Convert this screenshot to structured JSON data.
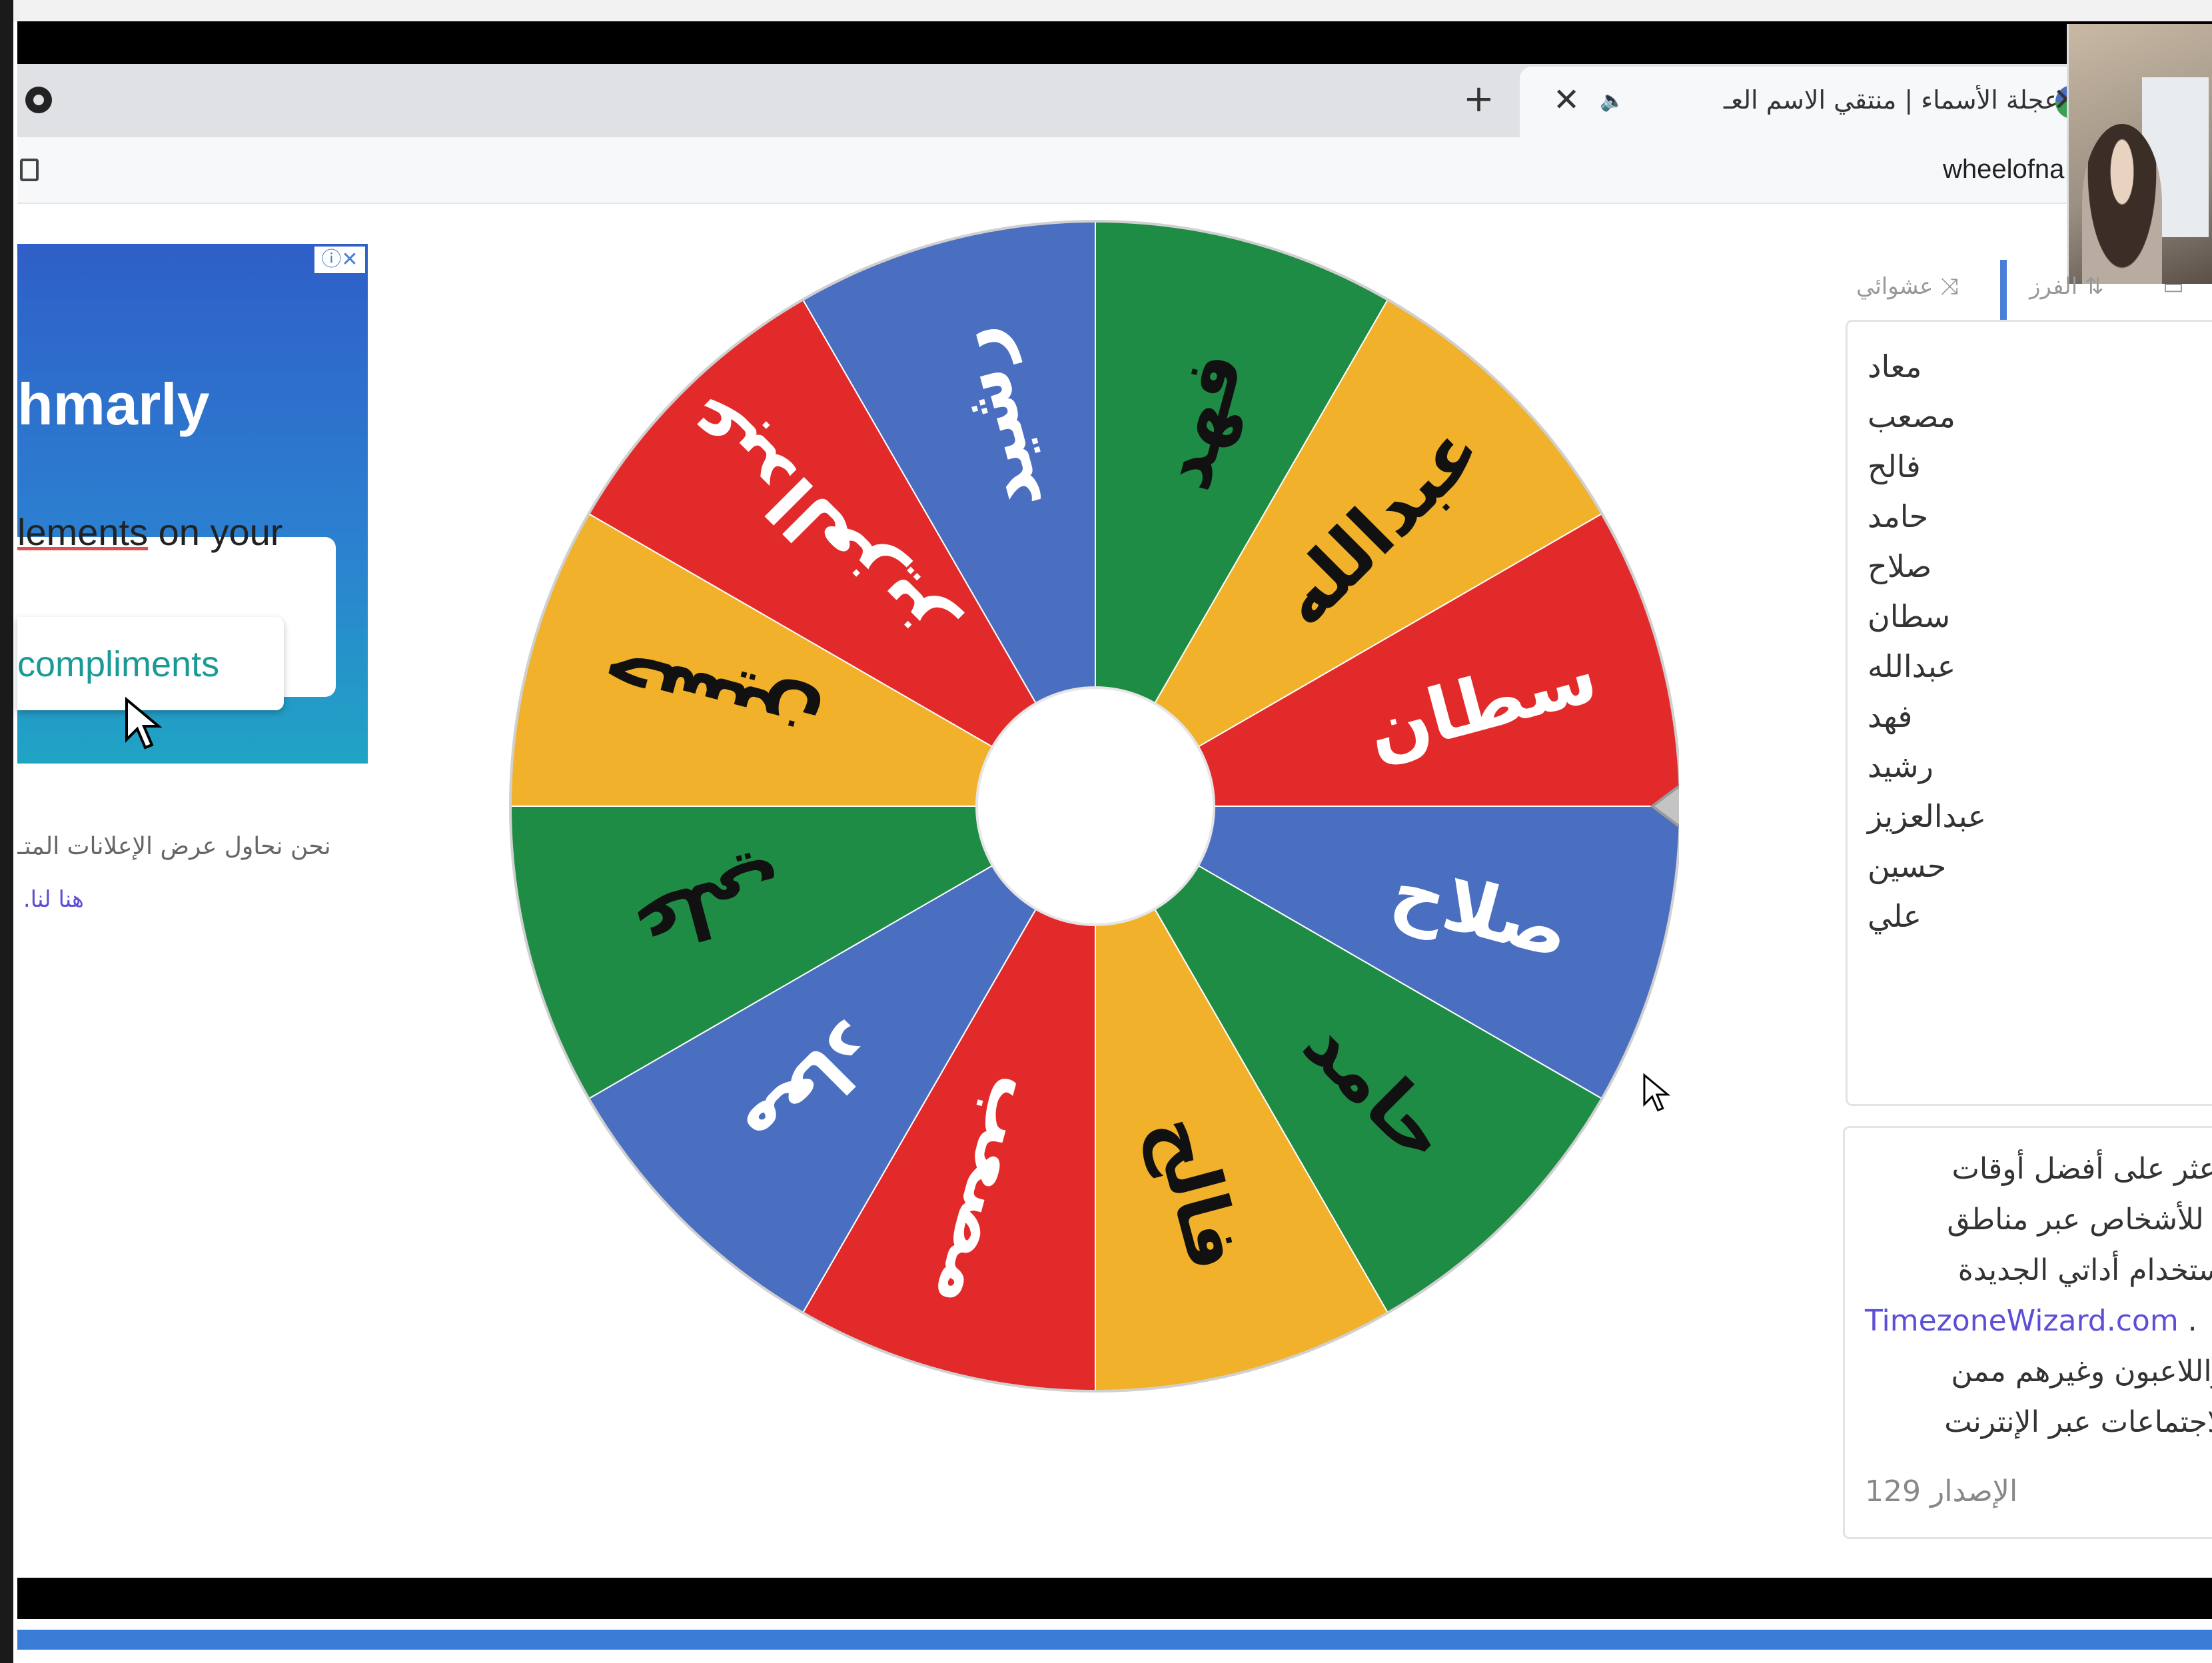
{
  "browser": {
    "tab_title": "عجلة الأسماء | منتقي الاسم العـ",
    "new_tab_symbol": "+",
    "close_symbol": "✕",
    "url": "wheelofna"
  },
  "ad": {
    "brand": "hmarly",
    "line1_highlight": "lements",
    "line1_rest": " on your",
    "line2": "compliments",
    "close_symbol": "ⓘ✕",
    "note": "نحن نحاول عرض الإعلانات المتـ",
    "link": "هنا لنا."
  },
  "panel": {
    "tab_shuffle": "عشوائي",
    "tab_sort": "الفرز",
    "tab_shuffle_icon": "shuffle-icon",
    "tab_sort_icon": "sort-icon",
    "names": [
      "معاد",
      "مصعب",
      "فالح",
      "حامد",
      "صلاح",
      "سطان",
      "عبدالله",
      "فهد",
      "رشيد",
      "عبدالعزيز",
      "حسين",
      "علي"
    ]
  },
  "info": {
    "line1": "اعثر على أفضل أوقات",
    "line2": "تماع للأشخاص عبر مناطق",
    "line3": "ة باستخدام أداتي الجديدة",
    "line4_link": "TimezoneWizard.com",
    "line4_rest": " . ",
    "line5": "ال واللاعبون وغيرهم ممن",
    "line6": "ن للاجتماعات عبر الإنترنت",
    "version": "الإصدار 129"
  },
  "wheel": {
    "segments": [
      {
        "label": "صلاح",
        "color": "#4a6fc1",
        "text_color": "#ffffff"
      },
      {
        "label": "حامد",
        "color": "#1e8c44",
        "text_color": "#111111"
      },
      {
        "label": "فالح",
        "color": "#f2b12a",
        "text_color": "#111111"
      },
      {
        "label": "مصعب",
        "color": "#e32a2a",
        "text_color": "#ffffff"
      },
      {
        "label": "معاد",
        "color": "#4a6fc1",
        "text_color": "#ffffff"
      },
      {
        "label": "علي",
        "color": "#1e8c44",
        "text_color": "#111111"
      },
      {
        "label": "حسين",
        "color": "#f2b12a",
        "text_color": "#111111"
      },
      {
        "label": "عبدالعزيز",
        "color": "#e32a2a",
        "text_color": "#ffffff"
      },
      {
        "label": "رشيد",
        "color": "#4a6fc1",
        "text_color": "#ffffff"
      },
      {
        "label": "فهد",
        "color": "#1e8c44",
        "text_color": "#111111"
      },
      {
        "label": "عبدالله",
        "color": "#f2b12a",
        "text_color": "#111111"
      },
      {
        "label": "سطان",
        "color": "#e32a2a",
        "text_color": "#ffffff"
      }
    ]
  }
}
